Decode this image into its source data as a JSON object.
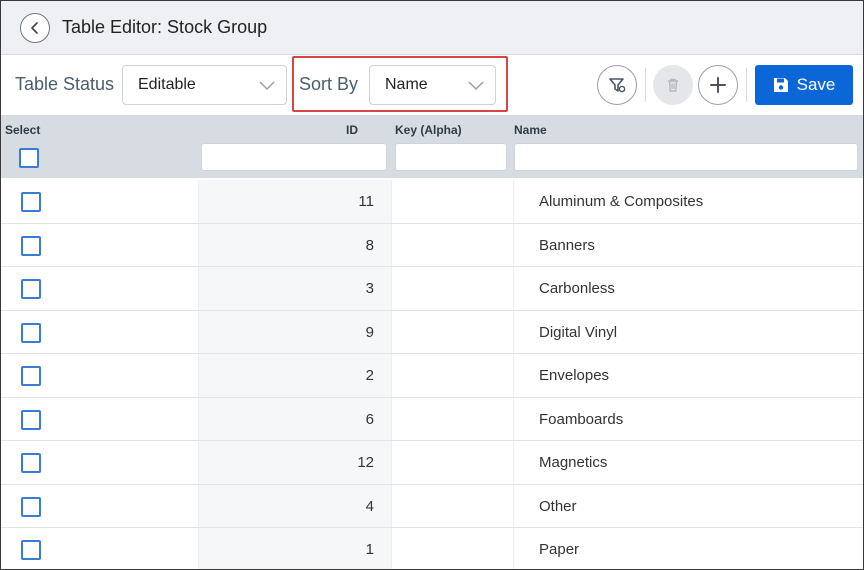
{
  "header": {
    "title": "Table Editor: Stock Group"
  },
  "toolbar": {
    "table_status_label": "Table Status",
    "table_status_value": "Editable",
    "sort_by_label": "Sort By",
    "sort_by_value": "Name",
    "save_label": "Save"
  },
  "grid": {
    "columns": {
      "select": "Select",
      "id": "ID",
      "key": "Key (Alpha)",
      "name": "Name"
    },
    "filters": {
      "id": "",
      "key": "",
      "name": ""
    },
    "rows": [
      {
        "id": "11",
        "key": "",
        "name": "Aluminum & Composites"
      },
      {
        "id": "8",
        "key": "",
        "name": "Banners"
      },
      {
        "id": "3",
        "key": "",
        "name": "Carbonless"
      },
      {
        "id": "9",
        "key": "",
        "name": "Digital Vinyl"
      },
      {
        "id": "2",
        "key": "",
        "name": "Envelopes"
      },
      {
        "id": "6",
        "key": "",
        "name": "Foamboards"
      },
      {
        "id": "12",
        "key": "",
        "name": "Magnetics"
      },
      {
        "id": "4",
        "key": "",
        "name": "Other"
      },
      {
        "id": "1",
        "key": "",
        "name": "Paper"
      }
    ]
  },
  "icons": {
    "back": "chevron-left-icon",
    "dropdown": "chevron-down-icon",
    "filter": "filter-settings-icon",
    "delete": "trash-icon",
    "add": "plus-icon",
    "save": "floppy-disk-icon"
  },
  "colors": {
    "accent": "#0b67d8",
    "highlight": "#d94444",
    "header_bg": "#d7dce2"
  }
}
